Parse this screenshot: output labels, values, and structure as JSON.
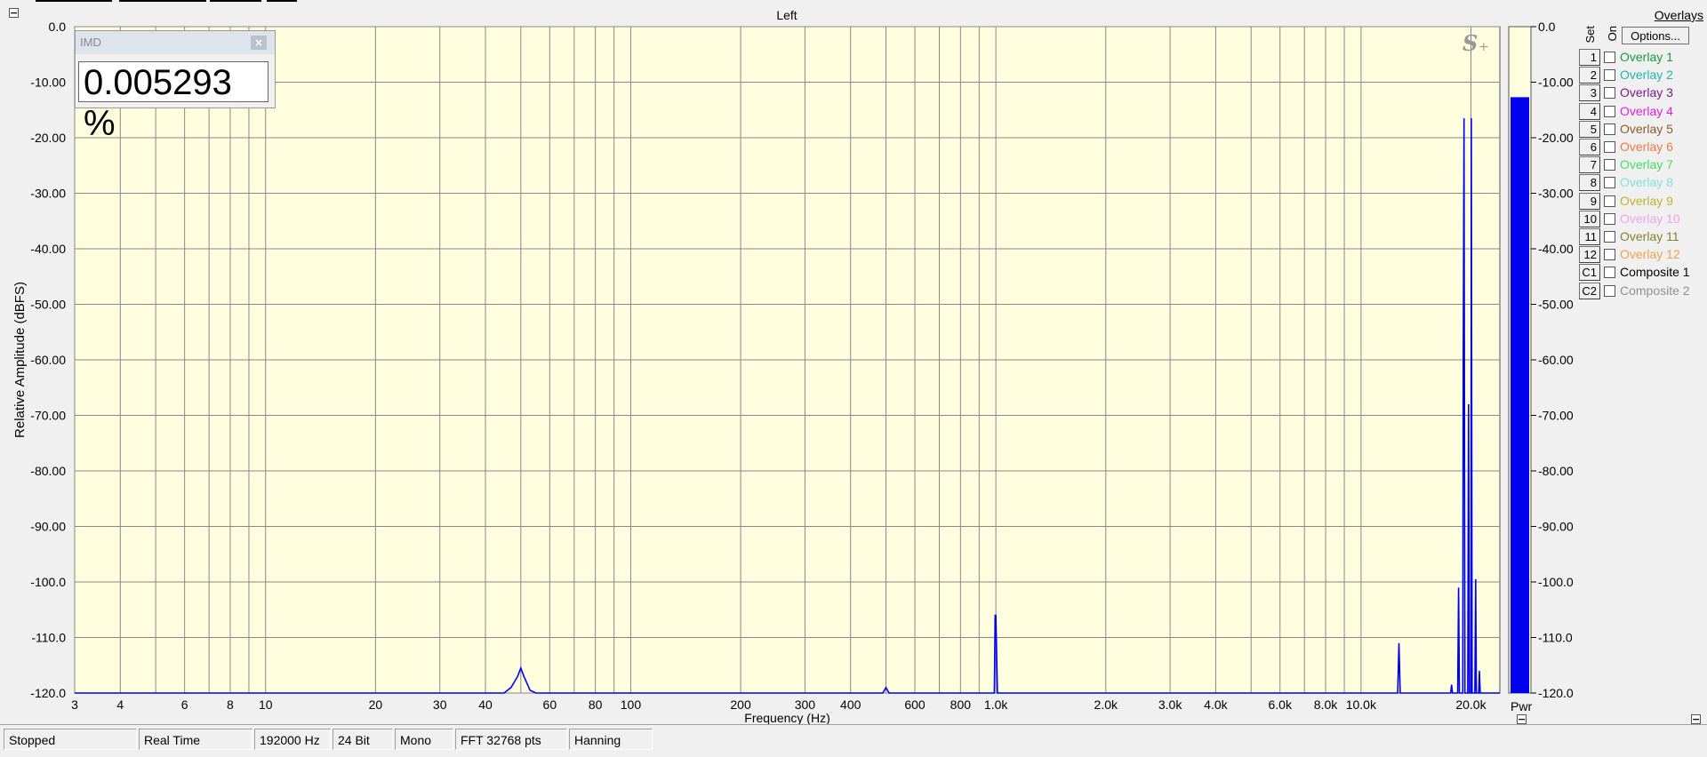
{
  "window": {
    "title": "Left"
  },
  "imd": {
    "label": "IMD",
    "close": "×",
    "value": "0.005293 %"
  },
  "overlays": {
    "title": "Overlays",
    "set_label": "Set",
    "on_label": "On",
    "options_label": "Options...",
    "items": [
      {
        "num": "1",
        "name": "Overlay 1",
        "color": "#1a9a3a"
      },
      {
        "num": "2",
        "name": "Overlay 2",
        "color": "#20b4b4"
      },
      {
        "num": "3",
        "name": "Overlay 3",
        "color": "#7a1a8a"
      },
      {
        "num": "4",
        "name": "Overlay 4",
        "color": "#e020e0"
      },
      {
        "num": "5",
        "name": "Overlay 5",
        "color": "#8a5a2a"
      },
      {
        "num": "6",
        "name": "Overlay 6",
        "color": "#f07840"
      },
      {
        "num": "7",
        "name": "Overlay 7",
        "color": "#40e060"
      },
      {
        "num": "8",
        "name": "Overlay 8",
        "color": "#80e0e0"
      },
      {
        "num": "9",
        "name": "Overlay 9",
        "color": "#c0b030"
      },
      {
        "num": "10",
        "name": "Overlay 10",
        "color": "#f0a0f0"
      },
      {
        "num": "11",
        "name": "Overlay 11",
        "color": "#808030"
      },
      {
        "num": "12",
        "name": "Overlay 12",
        "color": "#f0a050"
      },
      {
        "num": "C1",
        "name": "Composite 1",
        "color": "#000000"
      },
      {
        "num": "C2",
        "name": "Composite 2",
        "color": "#909090"
      }
    ]
  },
  "status": {
    "state": "Stopped",
    "mode": "Real Time",
    "rate": "192000 Hz",
    "bits": "24 Bit",
    "channels": "Mono",
    "fft": "FFT 32768 pts",
    "window": "Hanning"
  },
  "meter": {
    "label": "Pwr",
    "level_dbfs": -12.7,
    "ticks": [
      "0.0",
      "-10.00",
      "-20.00",
      "-30.00",
      "-40.00",
      "-50.00",
      "-60.00",
      "-70.00",
      "-80.00",
      "-90.00",
      "-100.0",
      "-110.0",
      "-120.0"
    ]
  },
  "chart_data": {
    "type": "line",
    "title": "Left",
    "xlabel": "Frequency (Hz)",
    "ylabel": "Relative Amplitude (dBFS)",
    "x_scale": "log",
    "xlim": [
      3,
      24000
    ],
    "ylim": [
      -120,
      0
    ],
    "x_ticks": [
      3,
      4,
      6,
      8,
      10,
      20,
      30,
      40,
      60,
      80,
      100,
      200,
      300,
      400,
      600,
      800,
      1000,
      2000,
      3000,
      4000,
      6000,
      8000,
      10000,
      20000
    ],
    "x_tick_labels": [
      "3",
      "4",
      "6",
      "8",
      "10",
      "20",
      "30",
      "40",
      "60",
      "80",
      "100",
      "200",
      "300",
      "400",
      "600",
      "800",
      "1.0k",
      "2.0k",
      "3.0k",
      "4.0k",
      "6.0k",
      "8.0k",
      "10.0k",
      "20.0k"
    ],
    "y_ticks": [
      0,
      -10,
      -20,
      -30,
      -40,
      -50,
      -60,
      -70,
      -80,
      -90,
      -100,
      -110,
      -120
    ],
    "y_tick_labels": [
      "0.0",
      "-10.00",
      "-20.00",
      "-30.00",
      "-40.00",
      "-50.00",
      "-60.00",
      "-70.00",
      "-80.00",
      "-90.00",
      "-100.0",
      "-110.0",
      "-120.0"
    ],
    "grid": true,
    "series": [
      {
        "color": "#0000ee",
        "points": [
          [
            3,
            -120
          ],
          [
            45,
            -120
          ],
          [
            47,
            -119
          ],
          [
            49,
            -117
          ],
          [
            50,
            -115.5
          ],
          [
            51,
            -117
          ],
          [
            53,
            -119.5
          ],
          [
            55,
            -120
          ],
          [
            490,
            -120
          ],
          [
            500,
            -119
          ],
          [
            510,
            -120
          ],
          [
            990,
            -120
          ],
          [
            995,
            -106
          ],
          [
            1000,
            -106
          ],
          [
            1005,
            -113
          ],
          [
            1010,
            -120
          ],
          [
            12600,
            -120
          ],
          [
            12700,
            -111
          ],
          [
            12800,
            -120
          ],
          [
            17600,
            -120
          ],
          [
            17700,
            -118.5
          ],
          [
            17800,
            -120
          ],
          [
            18400,
            -120
          ],
          [
            18500,
            -101
          ],
          [
            18600,
            -120
          ],
          [
            19000,
            -120
          ],
          [
            19050,
            -61
          ],
          [
            19150,
            -16.5
          ],
          [
            19250,
            -120
          ],
          [
            19600,
            -120
          ],
          [
            19700,
            -68
          ],
          [
            19800,
            -120
          ],
          [
            20000,
            -120
          ],
          [
            20050,
            -16.5
          ],
          [
            20150,
            -120
          ],
          [
            20500,
            -120
          ],
          [
            20600,
            -99.5
          ],
          [
            20700,
            -120
          ],
          [
            21000,
            -120
          ],
          [
            21100,
            -116
          ],
          [
            21200,
            -120
          ],
          [
            24000,
            -120
          ]
        ]
      }
    ]
  }
}
